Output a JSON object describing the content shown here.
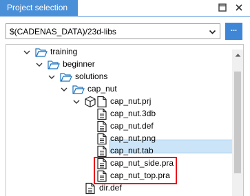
{
  "panel": {
    "title": "Project selection"
  },
  "path_combo": {
    "value": "$(CADENAS_DATA)/23d-libs"
  },
  "browse_button": {
    "label": "..."
  },
  "tree": {
    "items": [
      {
        "label": "training",
        "kind": "folder",
        "expanded": true
      },
      {
        "label": "beginner",
        "kind": "folder",
        "expanded": true
      },
      {
        "label": "solutions",
        "kind": "folder",
        "expanded": true
      },
      {
        "label": "cap_nut",
        "kind": "folder",
        "expanded": true
      },
      {
        "label": "cap_nut.prj",
        "kind": "project",
        "expanded": true,
        "selected": true
      },
      {
        "label": "cap_nut.3db",
        "kind": "file"
      },
      {
        "label": "cap_nut.def",
        "kind": "file"
      },
      {
        "label": "cap_nut.png",
        "kind": "file"
      },
      {
        "label": "cap_nut.tab",
        "kind": "file"
      },
      {
        "label": "cap_nut_side.pra",
        "kind": "file",
        "highlighted": true
      },
      {
        "label": "cap_nut_top.pra",
        "kind": "file",
        "highlighted": true
      },
      {
        "label": "dir.def",
        "kind": "file"
      }
    ]
  },
  "colors": {
    "title_tab": "#4a90d9",
    "browse_button": "#3f87d6",
    "selection": "#cce4f7",
    "highlight_box": "#e8121c",
    "folder_stroke": "#1e73be"
  }
}
